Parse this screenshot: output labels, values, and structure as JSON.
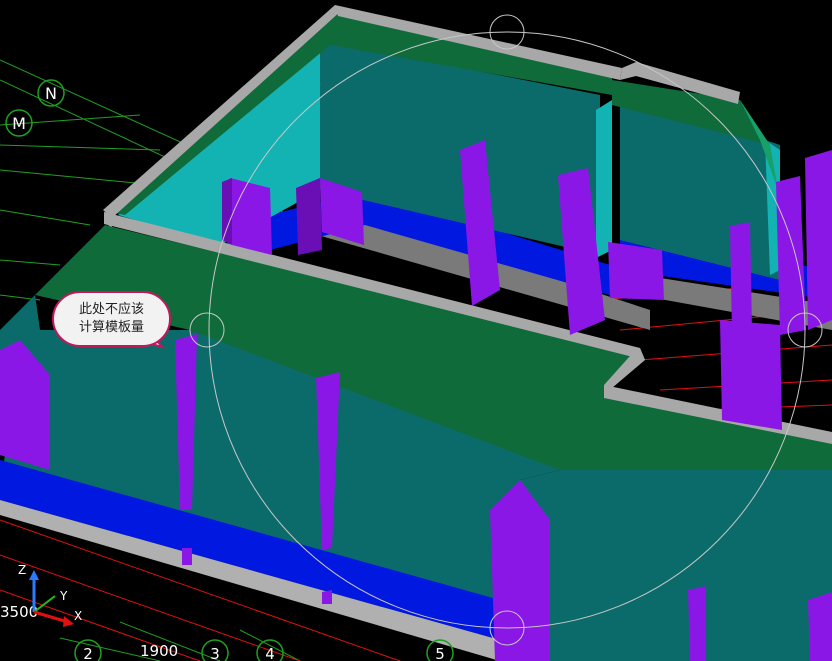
{
  "grid_axes": {
    "letters": [
      "N",
      "M"
    ],
    "numbers": [
      "2",
      "3",
      "4",
      "5"
    ]
  },
  "dimensions": {
    "left_value": "3500",
    "bottom_value": "1900"
  },
  "annotation": {
    "line1": "此处不应该",
    "line2": "计算模板量"
  },
  "coordinate_triad": {
    "z_label": "Z",
    "y_label": "Y",
    "x_label": "X"
  },
  "colors": {
    "background": "#000000",
    "slab_top": "#0f6b3a",
    "wall_teal": "#0b6b6b",
    "wall_cyan": "#13b3b3",
    "column_purple": "#8b17e6",
    "beam_blue": "#0018e0",
    "parapet_gray": "#a8a8a8",
    "grid_red": "#e01010",
    "grid_green": "#1fa01f",
    "callout_border": "#c2185b"
  },
  "icons": {
    "orbit_circle": "orbit-circle-icon",
    "axis_triad": "axis-triad-icon"
  }
}
